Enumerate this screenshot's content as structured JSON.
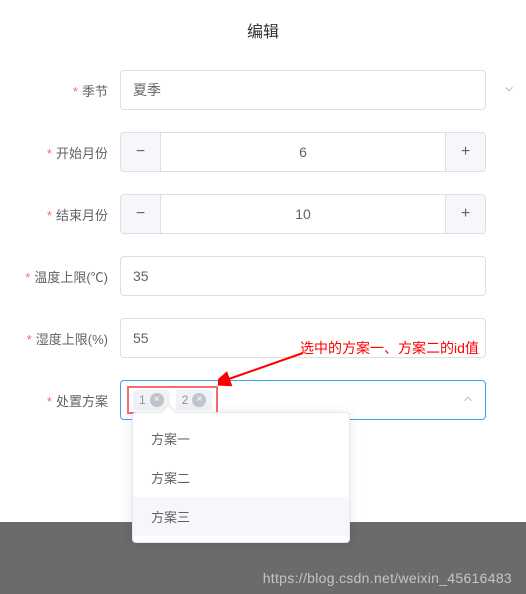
{
  "title": "编辑",
  "fields": {
    "season": {
      "label": "季节",
      "value": "夏季"
    },
    "start_month": {
      "label": "开始月份",
      "value": "6"
    },
    "end_month": {
      "label": "结束月份",
      "value": "10"
    },
    "temp_limit": {
      "label": "温度上限(℃)",
      "value": "35"
    },
    "humidity_limit": {
      "label": "湿度上限(%)",
      "value": "55"
    },
    "plan": {
      "label": "处置方案",
      "tags": [
        "1",
        "2"
      ]
    }
  },
  "dropdown_options": [
    "方案一",
    "方案二",
    "方案三"
  ],
  "annotation": "选中的方案一、方案二的id值",
  "watermark": "https://blog.csdn.net/weixin_45616483"
}
